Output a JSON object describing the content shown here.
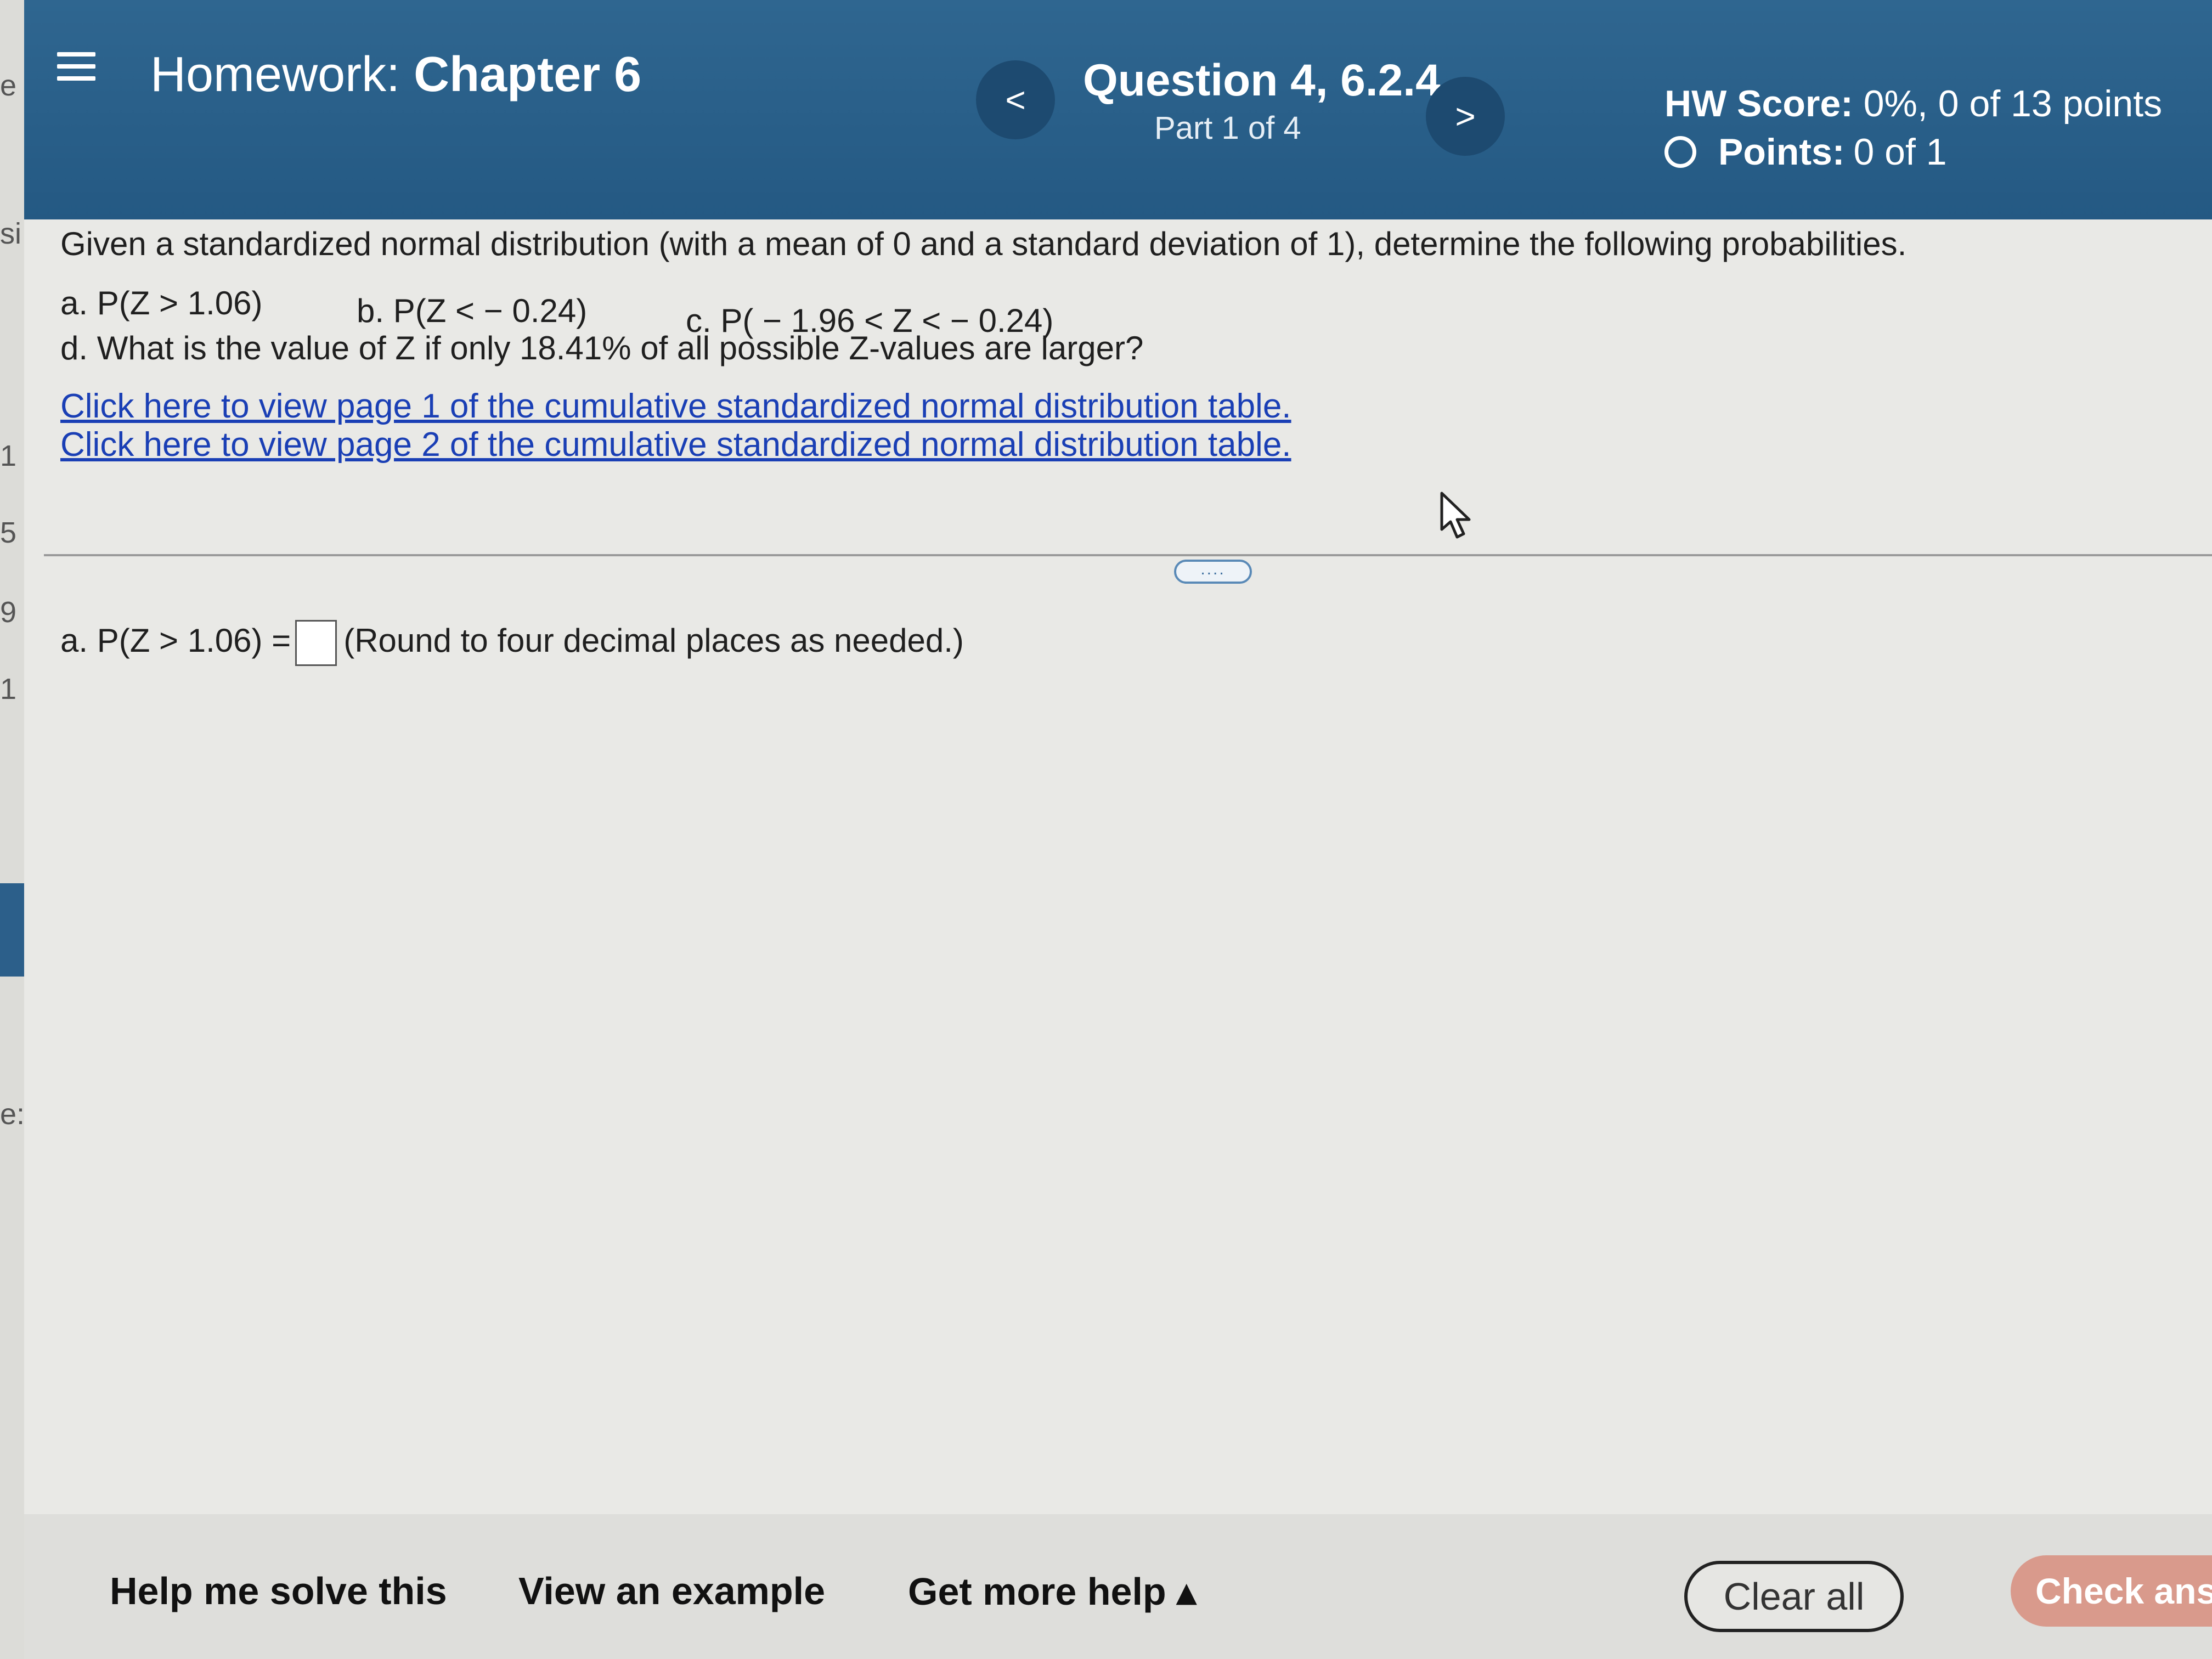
{
  "edge": {
    "chars": [
      "e",
      "si",
      "1",
      "5",
      "9",
      "1",
      "e:"
    ]
  },
  "header": {
    "title_prefix": "Homework:",
    "title_name": "Chapter 6",
    "question": "Question 4, 6.2.4",
    "part": "Part 1 of 4",
    "prev_label": "<",
    "next_label": ">",
    "hw_score_label": "HW Score:",
    "hw_score_value": "0%, 0 of 13 points",
    "points_label": "Points:",
    "points_value": "0 of 1"
  },
  "question": {
    "intro": "Given a standardized normal distribution (with a mean of 0 and a standard deviation of 1), determine the following probabilities.",
    "part_a": "a. P(Z > 1.06)",
    "part_b": "b. P(Z < − 0.24)",
    "part_c": "c. P( − 1.96 < Z < − 0.24)",
    "part_d": "d. What is the value of Z if only 18.41% of all possible Z-values are larger?",
    "link1": "Click here to view page 1 of the cumulative standardized normal distribution table.",
    "link2": "Click here to view page 2 of the cumulative standardized normal distribution table.",
    "more_label": "....",
    "answer_prompt": "a. P(Z > 1.06) =",
    "answer_hint": "(Round to four decimal places as needed.)",
    "answer_value": ""
  },
  "footer": {
    "help_solve": "Help me solve this",
    "view_example": "View an example",
    "more_help": "Get more help ▴",
    "clear_all": "Clear all",
    "check_answer": "Check ans"
  }
}
